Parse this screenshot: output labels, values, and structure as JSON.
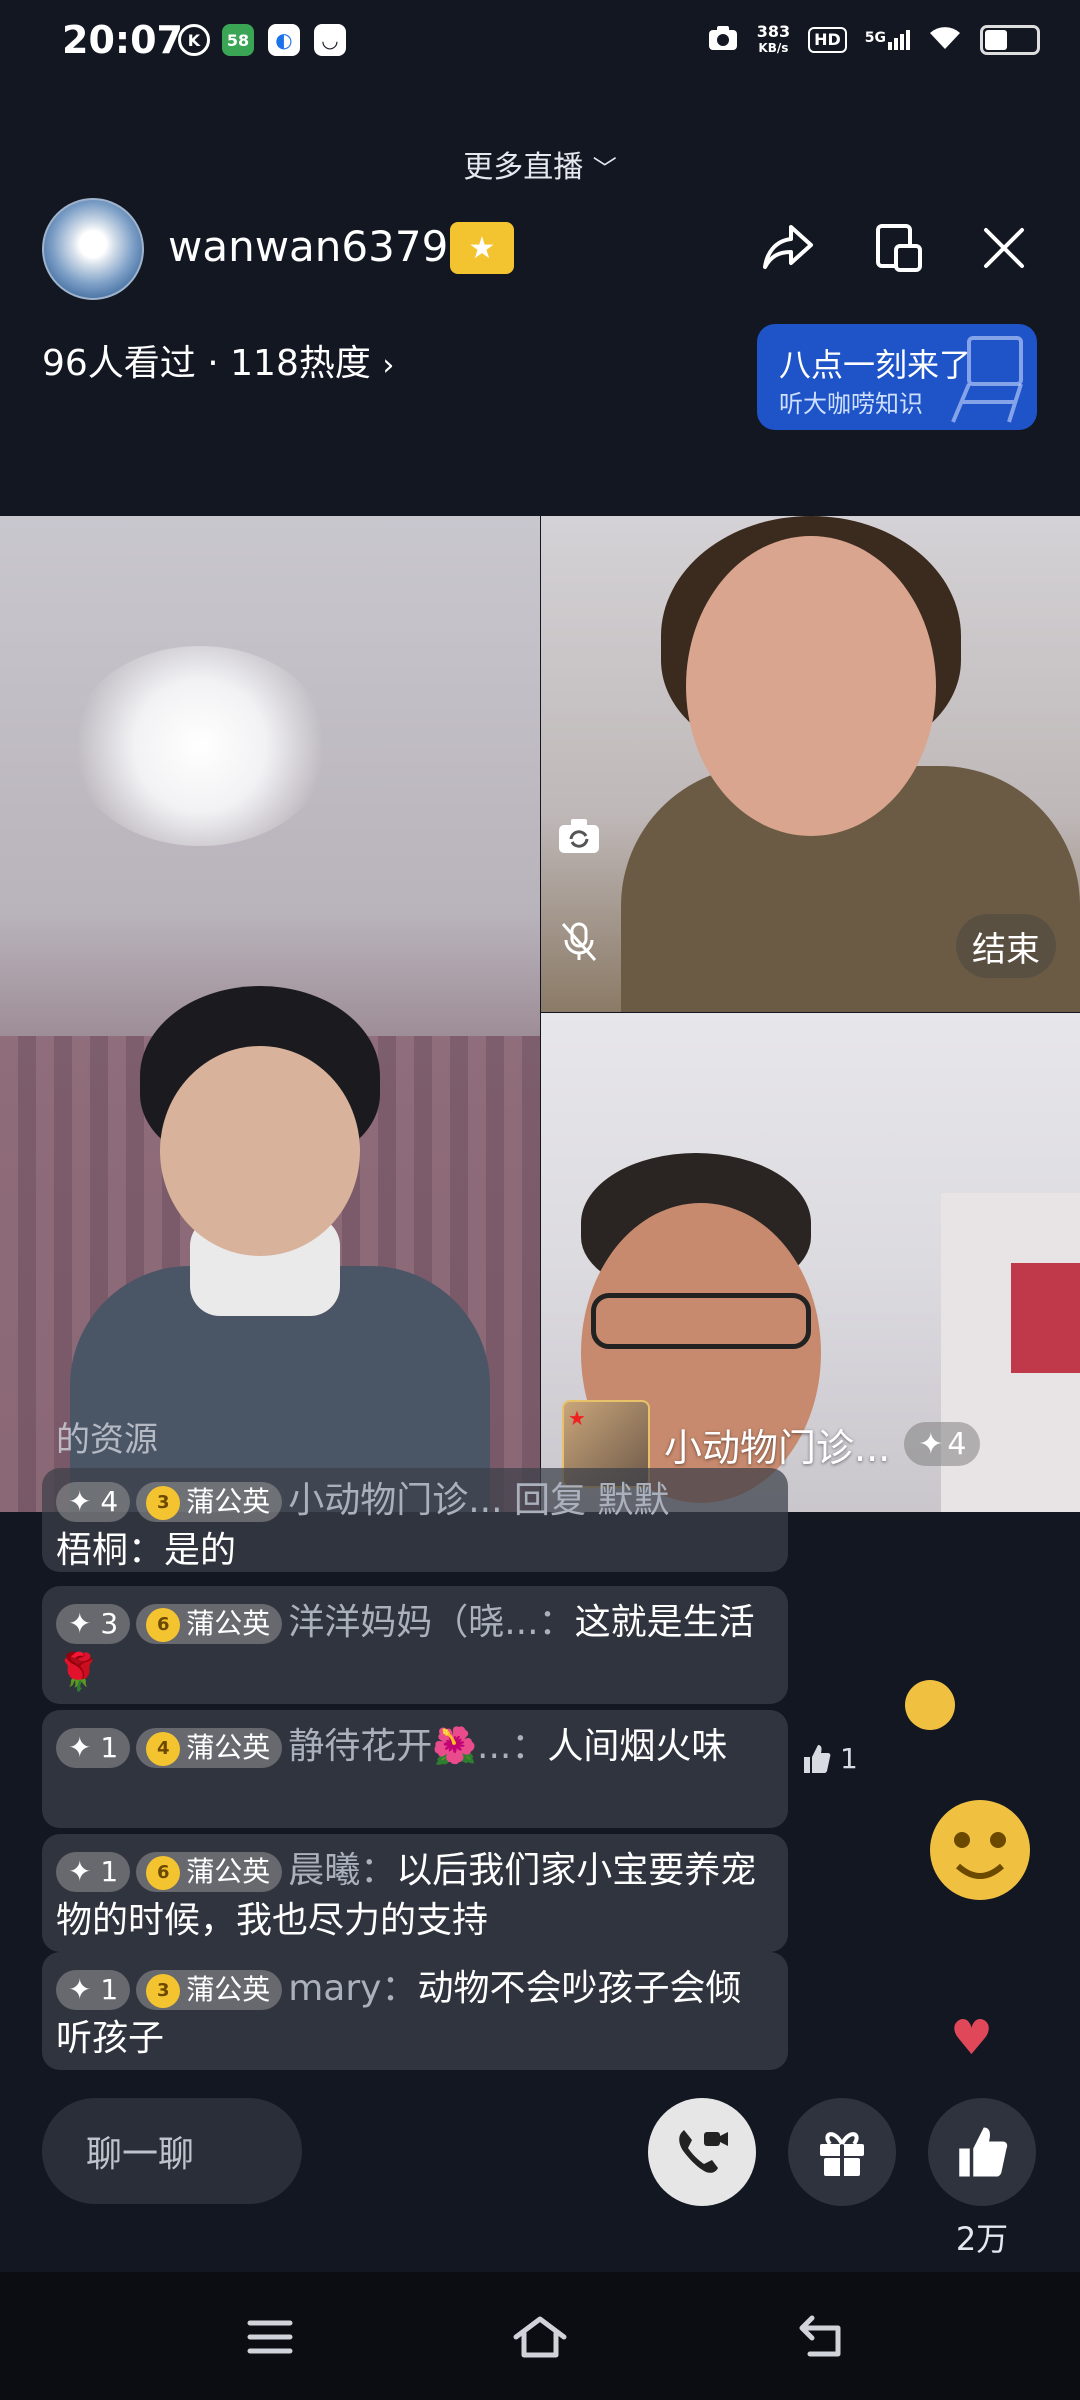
{
  "status_bar": {
    "time": "20:07",
    "net_speed_value": "383",
    "net_speed_unit": "KB/s",
    "hd": "HD",
    "signal": "5G"
  },
  "header": {
    "more_live": "更多直播",
    "streamer_name": "wanwan6379",
    "viewers": "96人看过 · 118热度"
  },
  "promo": {
    "title": "八点一刻来了",
    "subtitle": "听大咖唠知识"
  },
  "video": {
    "end_label": "结束",
    "guest_name": "小动物门诊...",
    "guest_level": "4"
  },
  "comments": {
    "resource_text": "的资源",
    "items": [
      {
        "level": "4",
        "fan_level": "3",
        "fan_name": "蒲公英",
        "user": "小动物门诊... 回复 默默",
        "text": "梧桐：是的"
      },
      {
        "level": "3",
        "fan_level": "6",
        "fan_name": "蒲公英",
        "user": "洋洋妈妈（晓...：",
        "text": "这就是生活🌹"
      },
      {
        "level": "1",
        "fan_level": "4",
        "fan_name": "蒲公英",
        "user": "静待花开🌺...：",
        "text": "人间烟火味"
      },
      {
        "level": "1",
        "fan_level": "6",
        "fan_name": "蒲公英",
        "user": "晨曦：",
        "text": "以后我们家小宝要养宠物的时候，我也尽力的支持"
      },
      {
        "level": "1",
        "fan_level": "3",
        "fan_name": "蒲公英",
        "user": "mary：",
        "text": "动物不会吵孩子会倾听孩子"
      }
    ]
  },
  "like_small": "1",
  "bottom": {
    "chat_placeholder": "聊一聊",
    "like_count": "2万"
  }
}
